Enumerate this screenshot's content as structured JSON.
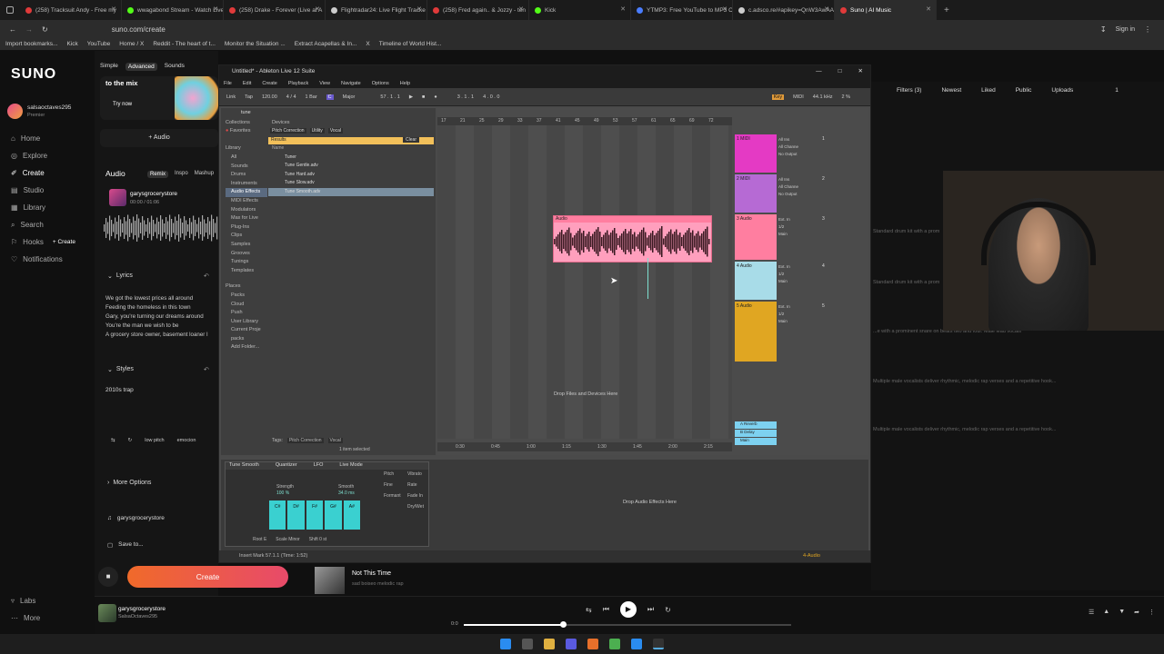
{
  "browser": {
    "tabs": [
      {
        "title": "(258) Tracksuit Andy - Free my",
        "color": "#e03a3a"
      },
      {
        "title": "wwagabond Stream - Watch Live",
        "color": "#53fc18"
      },
      {
        "title": "(258) Drake - Forever (Live at A",
        "color": "#e03a3a"
      },
      {
        "title": "Flightradar24: Live Flight Tracke",
        "color": "#cccccc"
      },
      {
        "title": "(258) Fred again.. & Jozzy - ten",
        "color": "#e03a3a"
      },
      {
        "title": "Kick",
        "color": "#53fc18"
      },
      {
        "title": "YTMP3: Free YouTube to MP3 C",
        "color": "#4a7dff"
      },
      {
        "title": "c.adsco.re/#apikey=QnW3AwAAA",
        "color": "#cccccc"
      },
      {
        "title": "Suno | AI Music",
        "color": "#e03a3a"
      }
    ],
    "url": "suno.com/create",
    "sign_in": "Sign in",
    "bookmarks": [
      "Import bookmarks...",
      "Kick",
      "YouTube",
      "Home / X",
      "Reddit - The heart of t...",
      "Monitor the Situation ...",
      "Extract Acapellas & In...",
      "X",
      "Timeline of World Hist..."
    ]
  },
  "suno": {
    "logo": "SUNO",
    "modes": [
      "Simple",
      "Advanced",
      "Sounds"
    ],
    "user": {
      "name": "salsaoctaves295",
      "tier": "Premier"
    },
    "nav": [
      "Home",
      "Explore",
      "Create",
      "Studio",
      "Library",
      "Search",
      "Hooks",
      "Notifications"
    ],
    "hooks_create": "+ Create",
    "bottom_nav": [
      "Labs",
      "More"
    ],
    "banner": {
      "title": "to the mix",
      "action": "Try now"
    },
    "add_audio": "+ Audio",
    "audio_label": "Audio",
    "audio_tabs": [
      "Remix",
      "Inspo",
      "Mashup"
    ],
    "clip": {
      "name": "garysgrocerystore",
      "time": "00:00 / 01:06"
    },
    "lyrics_label": "Lyrics",
    "lyrics_lines": [
      "We got the lowest prices all around",
      "Feeding the homeless in this town",
      "Gary, you're turning our dreams around",
      "You're the man we wish to be",
      "A grocery store owner, basement loaner l"
    ],
    "styles_label": "Styles",
    "styles_value": "2010s trap",
    "style_tags": [
      "low pitch",
      "emocion"
    ],
    "more_options": "More Options",
    "workspace": "garysgrocerystore",
    "save_to": "Save to...",
    "create_button": "Create",
    "right": {
      "filters": "Filters (3)",
      "sort": "Newest",
      "tabs": [
        "Liked",
        "Public",
        "Uploads"
      ],
      "page": "1",
      "descriptions": [
        "Standard drum kit with a prom",
        "Standard drum kit with a prom",
        "...e with a prominent snare on beats two and four. Male lead vocals",
        "Multiple male vocalists deliver rhythmic, melodic rap verses and a repetitive hook...",
        "Multiple male vocalists deliver rhythmic, melodic rap verses and a repetitive hook..."
      ]
    },
    "now_playing_list": {
      "title": "Not This Time",
      "sub": "sad boiseo melodic rap"
    },
    "player": {
      "title": "garysgrocerystore",
      "artist": "SalsaOctaves295",
      "time": "0:0"
    }
  },
  "ableton": {
    "title": "Untitled* - Ableton Live 12 Suite",
    "menu": [
      "File",
      "Edit",
      "Create",
      "Playback",
      "View",
      "Navigate",
      "Options",
      "Help"
    ],
    "transport": {
      "link": "Link",
      "tap": "Tap",
      "tempo": "120.00",
      "sig": "4 / 4",
      "bar": "1 Bar",
      "key": "C",
      "scale": "Major",
      "position": "57 . 1 . 1",
      "loop_start": "3 . 1 . 1",
      "loop_len": "4 . 0 . 0",
      "key_label": "Key",
      "midi_label": "MIDI",
      "sample_rate": "44.1 kHz",
      "cpu": "2 %"
    },
    "browser": {
      "search": "tune",
      "collections": "Collections",
      "favorites": "Favorites",
      "library": "Library",
      "library_items": [
        "All",
        "Sounds",
        "Drums",
        "Instruments",
        "Audio Effects",
        "MIDI Effects",
        "Modulators",
        "Max for Live",
        "Plug-Ins",
        "Clips",
        "Samples",
        "Grooves",
        "Tunings",
        "Templates"
      ],
      "places": "Places",
      "places_items": [
        "Packs",
        "Cloud",
        "Push",
        "User Library",
        "Current Proje",
        "packs",
        "Add Folder..."
      ],
      "crumb": "Devices",
      "filters": [
        "Pitch Correction",
        "Utility",
        "Vocal"
      ],
      "results_label": "Results",
      "clear": "Clear",
      "name_header": "Name",
      "results": [
        "Tuner",
        "Tune Gentle.adv",
        "Tune Hard.adv",
        "Tune Slow.adv",
        "Tune Smooth.adv"
      ],
      "tags_label": "Tags:",
      "tags": [
        "Pitch Correction",
        "Vocal"
      ],
      "selected": "1 item selected"
    },
    "ruler": [
      "17",
      "21",
      "25",
      "29",
      "33",
      "37",
      "41",
      "45",
      "49",
      "53",
      "57",
      "61",
      "65",
      "69",
      "72"
    ],
    "time_ruler": [
      "0:30",
      "0:45",
      "1:00",
      "1:15",
      "1:30",
      "1:45",
      "2:00",
      "2:15"
    ],
    "tracks": [
      {
        "name": "1 MIDI",
        "color": "#e43ac4",
        "in": "All Ins",
        "chan": "All Channe",
        "out": "No Output",
        "num": "1"
      },
      {
        "name": "2 MIDI",
        "color": "#b66ad4",
        "in": "All Ins",
        "chan": "All Channe",
        "out": "No Output",
        "num": "2"
      },
      {
        "name": "3 Audio",
        "color": "#ff7ea0",
        "in": "Ext. In",
        "chan": "1/2",
        "out": "Main",
        "num": "3"
      },
      {
        "name": "4 Audio",
        "color": "#a8dce8",
        "in": "Ext. In",
        "chan": "1/2",
        "out": "Main",
        "num": "4"
      },
      {
        "name": "5 Audio",
        "color": "#e0a622",
        "in": "Ext. In",
        "chan": "1/2",
        "out": "Main",
        "num": "5"
      }
    ],
    "returns": [
      {
        "name": "A Reverb",
        "color": "#7dd1f0"
      },
      {
        "name": "B Delay",
        "color": "#7dd1f0"
      },
      {
        "name": "Main",
        "color": "#7dd1f0"
      }
    ],
    "clip_label": "Audio",
    "drop_files": "Drop Files and Devices Here",
    "drop_audio": "Drop Audio Effects Here",
    "device": {
      "name": "Tune Smooth",
      "quantizer": "Quantizer",
      "lfo": "LFO",
      "live_mode": "Live Mode",
      "strength": "Strength",
      "strength_value": "100 %",
      "smooth": "Smooth",
      "smooth_value": "34.0 ms",
      "root": "Root E",
      "scale": "Scale Minor",
      "shift": "Shift 0 st",
      "pitch": "Pitch",
      "fine": "Fine",
      "formant": "Formant",
      "vibrato": "Vibrato",
      "rate": "Rate",
      "fade_in": "Fade In",
      "dry_wet": "Dry/Wet",
      "keys": [
        "C#",
        "D#",
        "F#",
        "G#",
        "A#"
      ]
    },
    "status": "Insert Mark 57.1.1 (Time: 1:52)",
    "status_track": "4-Audio"
  }
}
